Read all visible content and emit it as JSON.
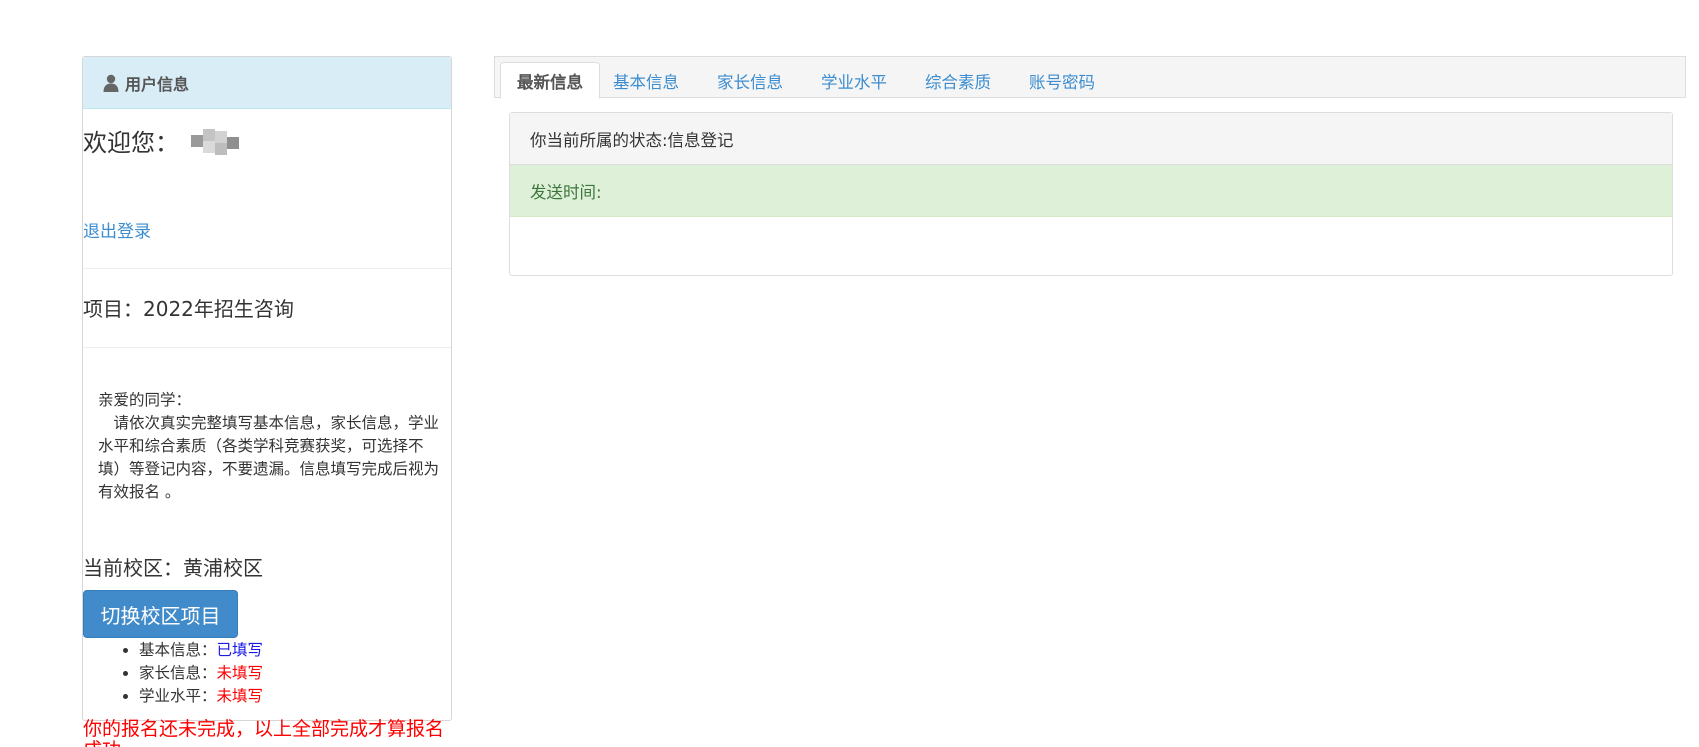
{
  "panel": {
    "title": "用户信息",
    "welcome_label": "欢迎您：",
    "logout_label": "退出登录",
    "project_text": "项目：2022年招生咨询",
    "notice": {
      "greeting": "亲爱的同学：",
      "body": "　请依次真实完整填写基本信息，家长信息，学业水平和综合素质（各类学科竞赛获奖，可选择不填）等登记内容，不要遗漏。信息填写完成后视为有效报名 。"
    },
    "campus_text": "当前校区：黄浦校区",
    "switch_button_label": "切换校区项目",
    "status_items": [
      {
        "label": "基本信息：",
        "value": "已填写",
        "state": "done"
      },
      {
        "label": "家长信息：",
        "value": "未填写",
        "state": "todo"
      },
      {
        "label": "学业水平：",
        "value": "未填写",
        "state": "todo"
      }
    ],
    "warning": "你的报名还未完成，以上全部完成才算报名成功"
  },
  "tabs": [
    {
      "label": "最新信息",
      "active": true
    },
    {
      "label": "基本信息",
      "active": false
    },
    {
      "label": "家长信息",
      "active": false
    },
    {
      "label": "学业水平",
      "active": false
    },
    {
      "label": "综合素质",
      "active": false
    },
    {
      "label": "账号密码",
      "active": false
    }
  ],
  "content": {
    "state_text": "你当前所属的状态:信息登记",
    "send_time_label": "发送时间:"
  },
  "colors": {
    "link": "#3c8dd0",
    "primary_button": "#428bca",
    "heading_bg": "#d9edf7",
    "success_bg": "#dff0d8",
    "success_text": "#3c763d",
    "done": "#1a1ae6",
    "todo": "#ff0000"
  },
  "icons": {
    "panel_heading": "user-icon"
  }
}
